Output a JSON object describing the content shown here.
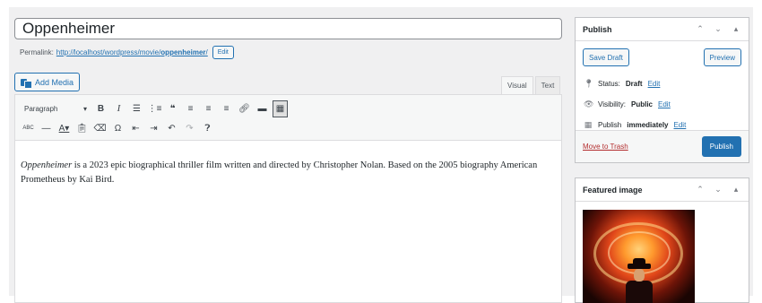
{
  "title": {
    "value": "Oppenheimer"
  },
  "permalink": {
    "label": "Permalink:",
    "base": "http://localhost/wordpress/movie/",
    "slug": "oppenheimer",
    "trailing": "/",
    "edit_label": "Edit"
  },
  "add_media_label": "Add Media",
  "editor_tabs": {
    "visual": "Visual",
    "text": "Text"
  },
  "toolbar": {
    "format_select": "Paragraph",
    "row1_icons": [
      "bold-icon",
      "italic-icon",
      "bullet-list-icon",
      "numbered-list-icon",
      "blockquote-icon",
      "align-left-icon",
      "align-center-icon",
      "align-right-icon",
      "link-icon",
      "read-more-icon",
      "toolbar-toggle-icon"
    ],
    "row2_icons": [
      "strikethrough-icon",
      "horizontal-line-icon",
      "text-color-icon",
      "paste-as-text-icon",
      "clear-formatting-icon",
      "special-character-icon",
      "outdent-icon",
      "indent-icon",
      "undo-icon",
      "redo-icon",
      "help-icon"
    ]
  },
  "content": {
    "emphasis": "Oppenheimer",
    "rest": " is a 2023 epic biographical thriller film written and directed by Christopher Nolan. Based on the 2005 biography American Prometheus by Kai Bird."
  },
  "publish": {
    "title": "Publish",
    "save_draft": "Save Draft",
    "preview": "Preview",
    "status_label": "Status:",
    "status_value": "Draft",
    "visibility_label": "Visibility:",
    "visibility_value": "Public",
    "publish_label": "Publish",
    "publish_value": "immediately",
    "edit": "Edit",
    "trash": "Move to Trash",
    "publish_button": "Publish"
  },
  "featured": {
    "title": "Featured image"
  },
  "colors": {
    "accent": "#2271b1",
    "danger": "#b32d2e",
    "background": "#f0f0f1"
  }
}
